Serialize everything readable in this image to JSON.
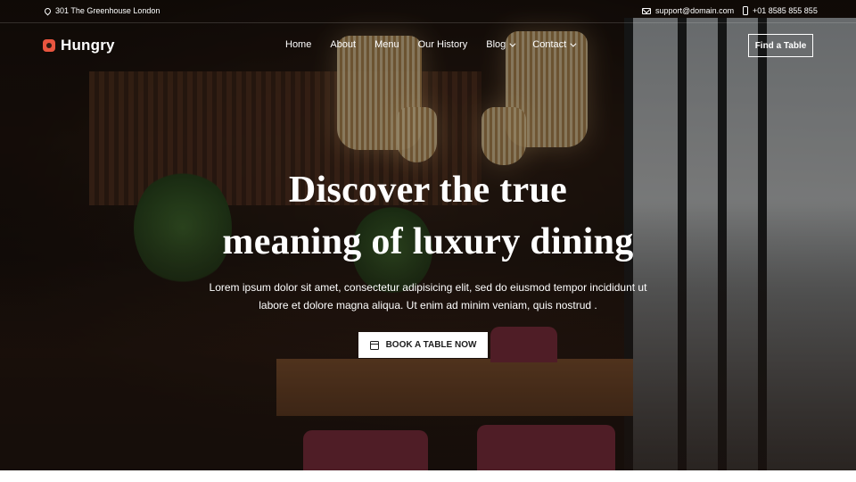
{
  "topbar": {
    "address": "301 The Greenhouse London",
    "email": "support@domain.com",
    "phone": "+01 8585 855 855"
  },
  "brand": {
    "name": "Hungry"
  },
  "nav": {
    "items": [
      {
        "label": "Home"
      },
      {
        "label": "About"
      },
      {
        "label": "Menu"
      },
      {
        "label": "Our History"
      },
      {
        "label": "Blog"
      },
      {
        "label": "Contact"
      }
    ],
    "cta_label": "Find a Table"
  },
  "hero": {
    "headline_line1": "Discover the true",
    "headline_line2": "meaning of luxury dining",
    "subtext": "Lorem ipsum dolor sit amet, consectetur adipisicing elit, sed do eiusmod tempor incididunt ut labore et dolore magna aliqua. Ut enim ad minim veniam, quis nostrud .",
    "button_label": "BOOK A TABLE NOW"
  },
  "colors": {
    "brand_accent": "#e8553f",
    "text_on_dark": "#ffffff",
    "button_bg": "#ffffff"
  },
  "icons": [
    "location-pin-icon",
    "mail-icon",
    "phone-icon",
    "logo-icon",
    "chevron-down-icon",
    "calendar-icon"
  ]
}
